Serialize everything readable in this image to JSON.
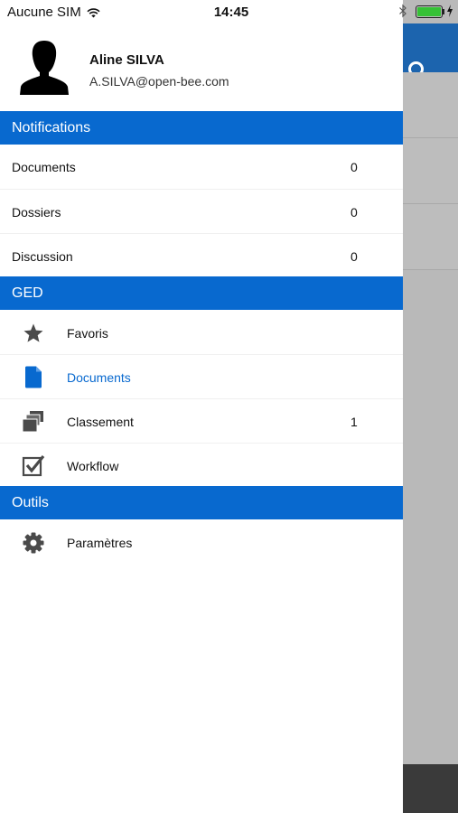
{
  "status_bar": {
    "carrier": "Aucune SIM",
    "time": "14:45"
  },
  "profile": {
    "name": "Aline SILVA",
    "email": "A.SILVA@open-bee.com"
  },
  "sections": {
    "notifications": {
      "title": "Notifications",
      "items": [
        {
          "label": "Documents",
          "count": "0"
        },
        {
          "label": "Dossiers",
          "count": "0"
        },
        {
          "label": "Discussion",
          "count": "0"
        }
      ]
    },
    "ged": {
      "title": "GED",
      "items": [
        {
          "label": "Favoris",
          "icon": "star-icon",
          "count": ""
        },
        {
          "label": "Documents",
          "icon": "document-icon",
          "count": ""
        },
        {
          "label": "Classement",
          "icon": "boxes-icon",
          "count": "1"
        },
        {
          "label": "Workflow",
          "icon": "checkbox-icon",
          "count": ""
        }
      ]
    },
    "outils": {
      "title": "Outils",
      "items": [
        {
          "label": "Paramètres",
          "icon": "gear-icon"
        }
      ]
    }
  },
  "colors": {
    "accent": "#0869cf",
    "header_bg": "#1c64ae",
    "battery": "#35c135"
  }
}
